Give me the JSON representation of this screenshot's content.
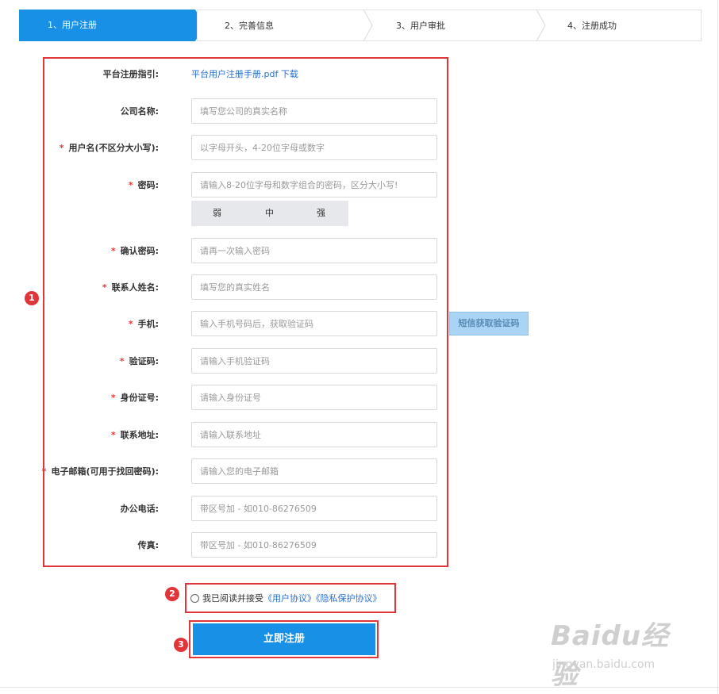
{
  "steps": [
    {
      "label": "1、用户注册"
    },
    {
      "label": "2、完善信息"
    },
    {
      "label": "3、用户审批"
    },
    {
      "label": "4、注册成功"
    }
  ],
  "guide": {
    "label": "平台注册指引:",
    "link": "平台用户注册手册.pdf 下载"
  },
  "fields": {
    "company": {
      "label": "公司名称:",
      "required": false,
      "placeholder": "填写您公司的真实名称"
    },
    "username": {
      "label": "用户名(不区分大小写):",
      "required": true,
      "placeholder": "以字母开头，4-20位字母或数字"
    },
    "password": {
      "label": "密码:",
      "required": true,
      "placeholder": "请输入8-20位字母和数字组合的密码，区分大小写!"
    },
    "confirm_password": {
      "label": "确认密码:",
      "required": true,
      "placeholder": "请再一次输入密码"
    },
    "contact_name": {
      "label": "联系人姓名:",
      "required": true,
      "placeholder": "填写您的真实姓名"
    },
    "mobile": {
      "label": "手机:",
      "required": true,
      "placeholder": "输入手机号码后，获取验证码"
    },
    "code": {
      "label": "验证码:",
      "required": true,
      "placeholder": "请输入手机验证码"
    },
    "id_number": {
      "label": "身份证号:",
      "required": true,
      "placeholder": "请输入身份证号"
    },
    "address": {
      "label": "联系地址:",
      "required": true,
      "placeholder": "请输入联系地址"
    },
    "email": {
      "label": "电子邮箱(可用于找回密码):",
      "required": true,
      "placeholder": "请输入您的电子邮箱"
    },
    "office_phone": {
      "label": "办公电话:",
      "required": false,
      "placeholder": "带区号加 - 如010-86276509"
    },
    "fax": {
      "label": "传真:",
      "required": false,
      "placeholder": "带区号加 - 如010-86276509"
    }
  },
  "required_mark": "*",
  "strength": {
    "weak": "弱",
    "medium": "中",
    "strong": "强"
  },
  "sms_button": "短信获取验证码",
  "agreement": {
    "text": "我已阅读并接受",
    "user_link": "《用户协议》",
    "privacy_link": "《隐私保护协议》"
  },
  "submit": "立即注册",
  "annotations": [
    "1",
    "2",
    "3"
  ],
  "watermark": {
    "main": "Baidu经验",
    "sub": "jingyan.baidu.com"
  },
  "colors": {
    "primary": "#1890e6",
    "annotation": "#e2353a",
    "required": "#e4393c",
    "link": "#2a6fcb"
  }
}
